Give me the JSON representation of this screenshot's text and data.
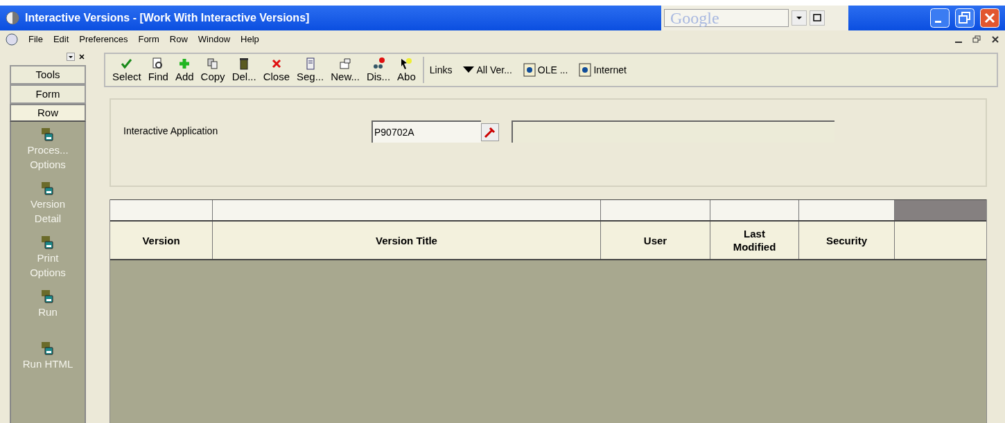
{
  "window": {
    "title": "Interactive Versions - [Work With Interactive Versions]"
  },
  "google_bar": {
    "logo": "Google"
  },
  "menu": [
    "File",
    "Edit",
    "Preferences",
    "Form",
    "Row",
    "Window",
    "Help"
  ],
  "side_tabs": [
    {
      "label": "Tools",
      "selected": false
    },
    {
      "label": "Form",
      "selected": false
    },
    {
      "label": "Row",
      "selected": true
    }
  ],
  "row_exits": [
    {
      "label": "Proces... Options"
    },
    {
      "label": "Version Detail"
    },
    {
      "label": "Print Options"
    },
    {
      "label": "Run"
    },
    {
      "label": "Run HTML"
    }
  ],
  "toolbar": [
    {
      "label": "Select",
      "kind": "check"
    },
    {
      "label": "Find",
      "kind": "find"
    },
    {
      "label": "Add",
      "kind": "plus"
    },
    {
      "label": "Copy",
      "kind": "copy"
    },
    {
      "label": "Del...",
      "kind": "trash"
    },
    {
      "label": "Close",
      "kind": "x"
    },
    {
      "label": "Seg...",
      "kind": "doc"
    },
    {
      "label": "New...",
      "kind": "new"
    },
    {
      "label": "Dis...",
      "kind": "dis"
    },
    {
      "label": "Abo",
      "kind": "about"
    }
  ],
  "links": [
    {
      "label": "Links",
      "kind": "text"
    },
    {
      "label": "All Ver...",
      "kind": "dropdown"
    },
    {
      "label": "OLE ...",
      "kind": "doc"
    },
    {
      "label": "Internet",
      "kind": "doc"
    }
  ],
  "form": {
    "label": "Interactive Application",
    "value": "P90702A"
  },
  "grid": {
    "columns": [
      "Version",
      "Version Title",
      "User",
      "Last\nModified",
      "Security"
    ]
  }
}
